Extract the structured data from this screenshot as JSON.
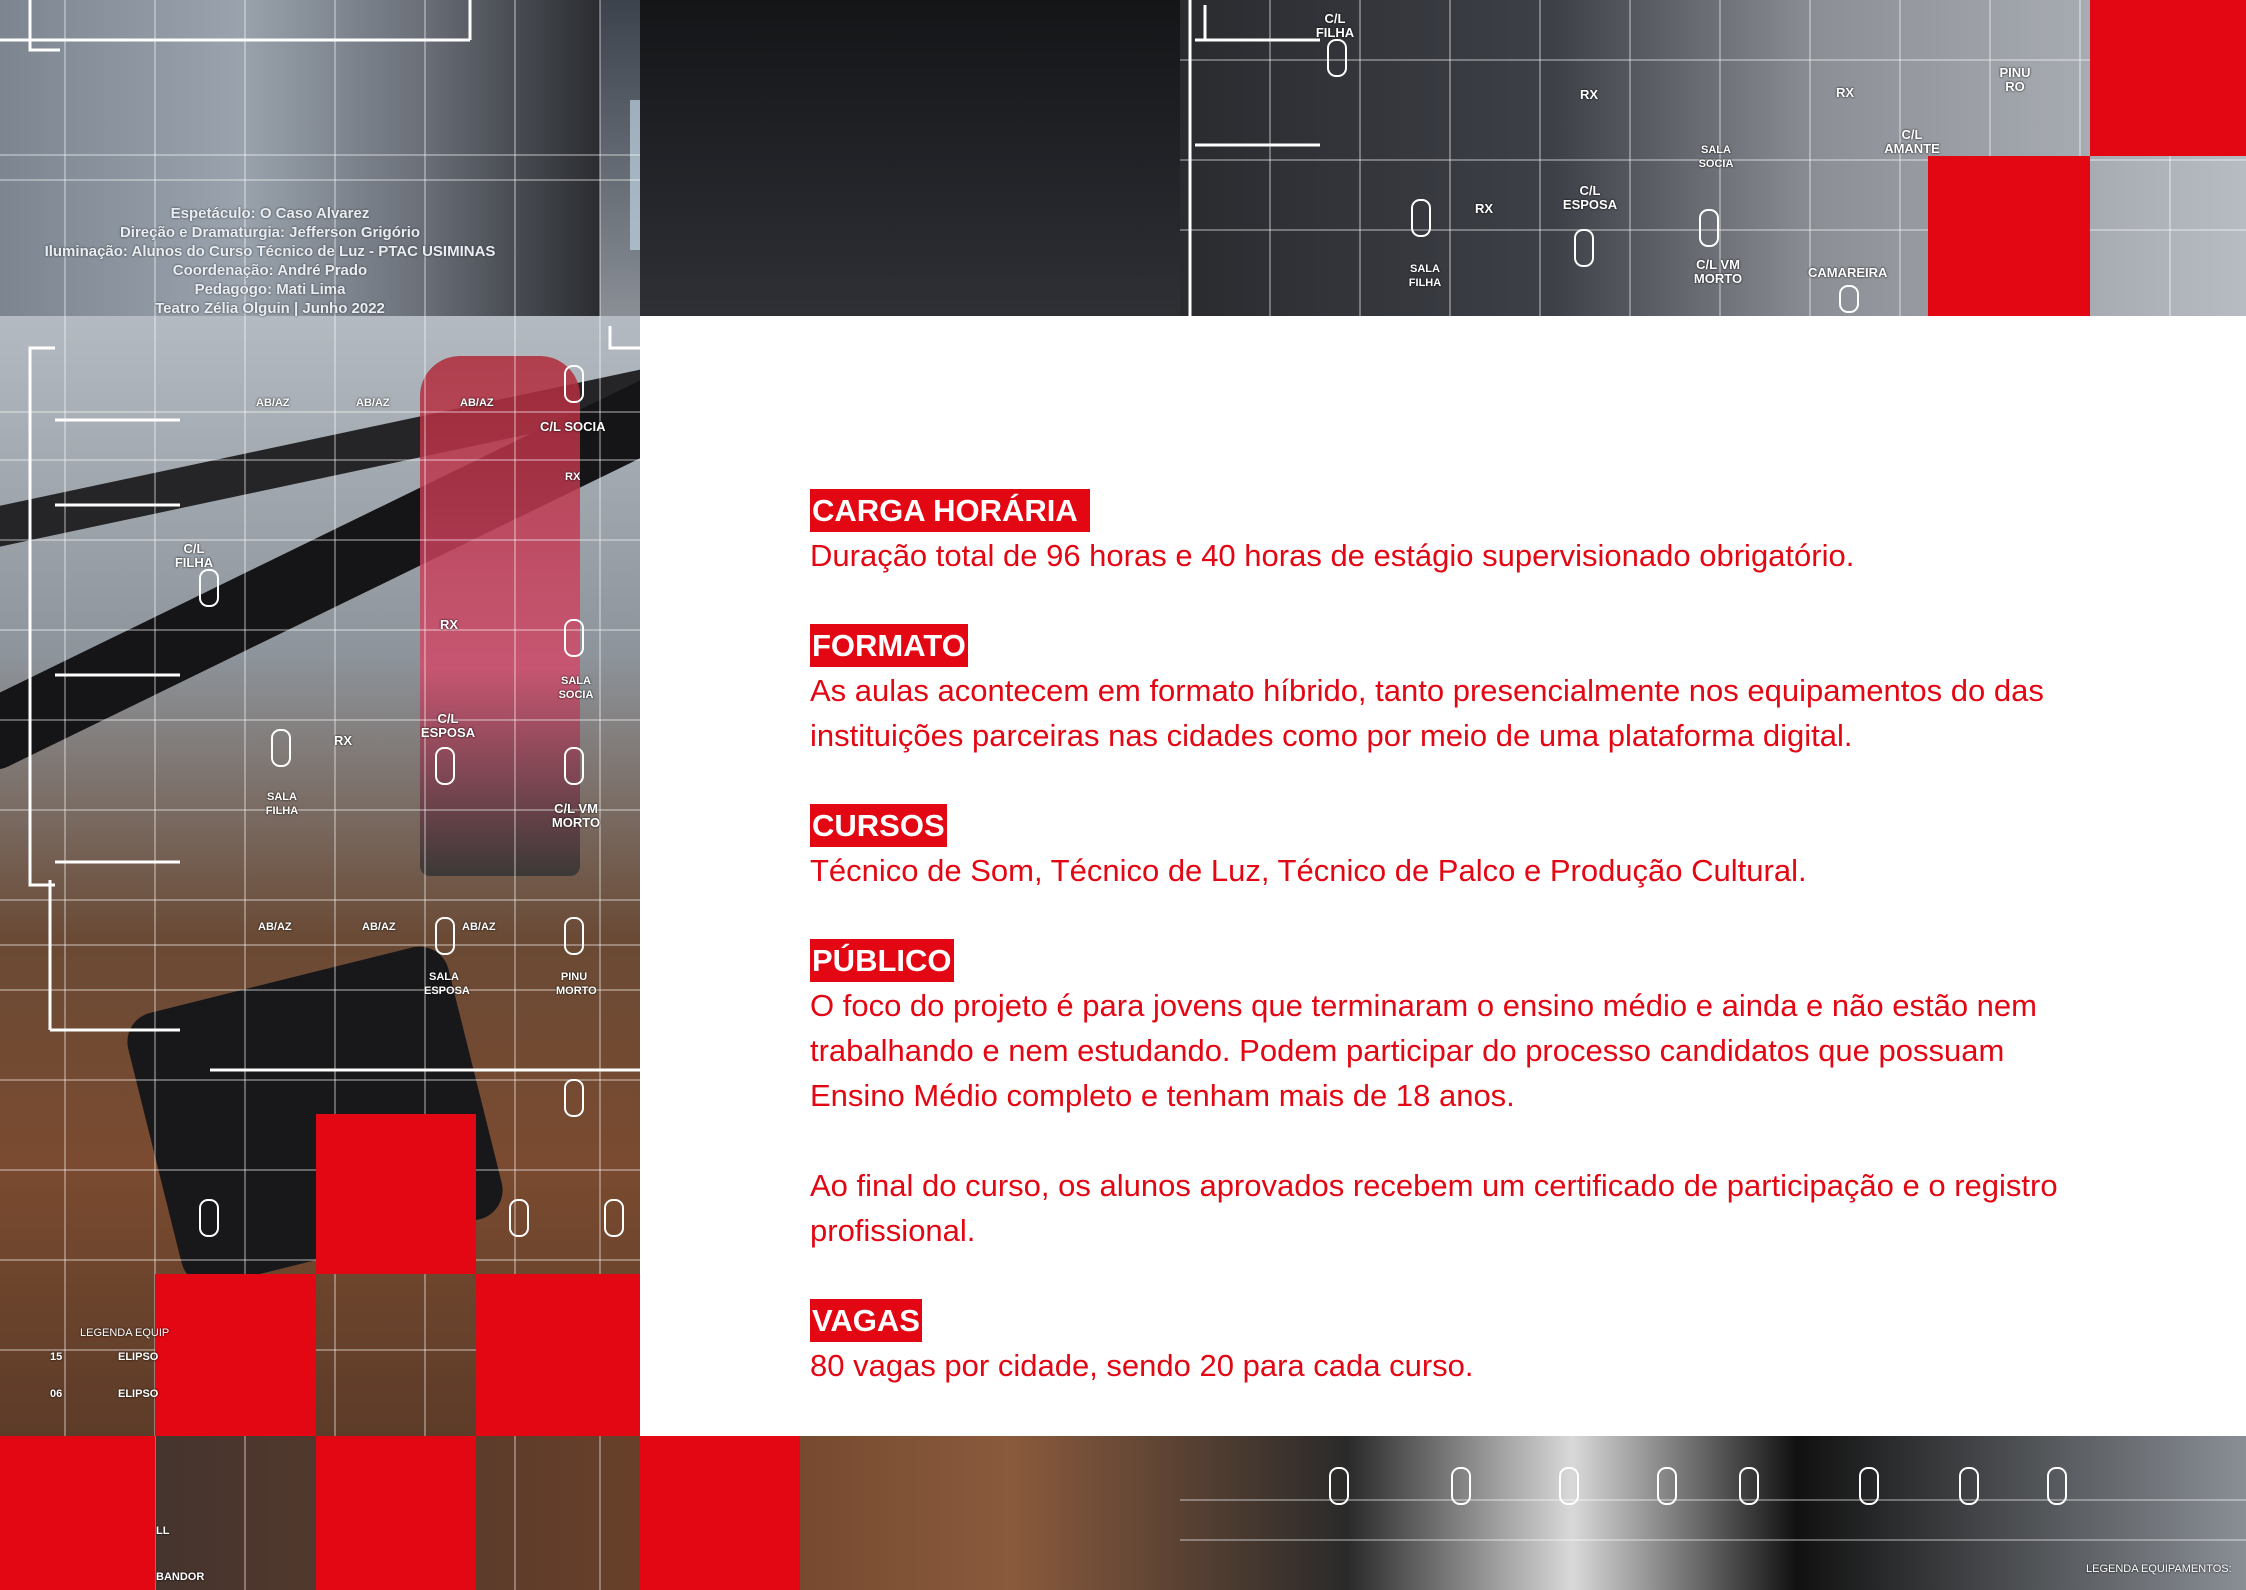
{
  "credits": [
    "Espetáculo: O Caso Alvarez",
    "Direção e Dramaturgia: Jefferson Grigório",
    "Iluminação: Alunos do Curso Técnico de Luz - PTAC USIMINAS",
    "Coordenação: André Prado",
    "Pedagogo: Mati Lima",
    "Teatro Zélia Olguin | Junho 2022"
  ],
  "plot_labels": {
    "top": [
      "C/L FILHA",
      "RX",
      "SALA SOCIA",
      "RX",
      "PINU RO",
      "C/L AMANTE",
      "C/L ESPOSA",
      "RX",
      "SALA FILHA",
      "C/L VM MORTO",
      "CAMAREIRA"
    ],
    "left": [
      "AB/AZ",
      "AB/AZ",
      "AB/AZ",
      "C/L SOCIA",
      "RX",
      "C/L FILHA",
      "RX",
      "SALA SOCIA",
      "C/L ESPOSA",
      "RX",
      "SALA FILHA",
      "C/L VM MORTO",
      "AB/AZ",
      "AB/AZ",
      "AB/AZ",
      "SALA ESPOSA",
      "PINU MORTO"
    ],
    "legend_left": [
      "LEGENDA EQUIP",
      "15",
      "ELIPSO",
      "06",
      "ELIPSO",
      "BANDOR",
      "LL"
    ],
    "legend_right": "LEGENDA EQUIPAMENTOS:"
  },
  "sections": [
    {
      "heading": "CARGA HORÁRIA",
      "body": "Duração total de 96 horas e 40 horas de estágio supervisionado obrigatório."
    },
    {
      "heading": "FORMATO",
      "body": "As aulas acontecem em formato híbrido, tanto presencialmente nos equipamentos do das instituições parceiras nas cidades como por meio de uma plataforma digital."
    },
    {
      "heading": "CURSOS",
      "body": "Técnico de Som, Técnico de Luz, Técnico de Palco e Produção Cultural."
    },
    {
      "heading": "PÚBLICO",
      "body": "O foco do projeto é para jovens que terminaram o ensino médio e ainda e não estão nem trabalhando e nem estudando. Podem participar do processo candidatos que possuam Ensino Médio completo e tenham mais de 18 anos.",
      "body2": "Ao final do curso, os alunos aprovados recebem um certificado de participação e o registro profissional."
    },
    {
      "heading": "VAGAS",
      "body": "80 vagas por cidade, sendo 20 para cada curso."
    }
  ],
  "colors": {
    "accent": "#e30613",
    "panel": "#ffffff",
    "heading_text": "#ffffff"
  }
}
